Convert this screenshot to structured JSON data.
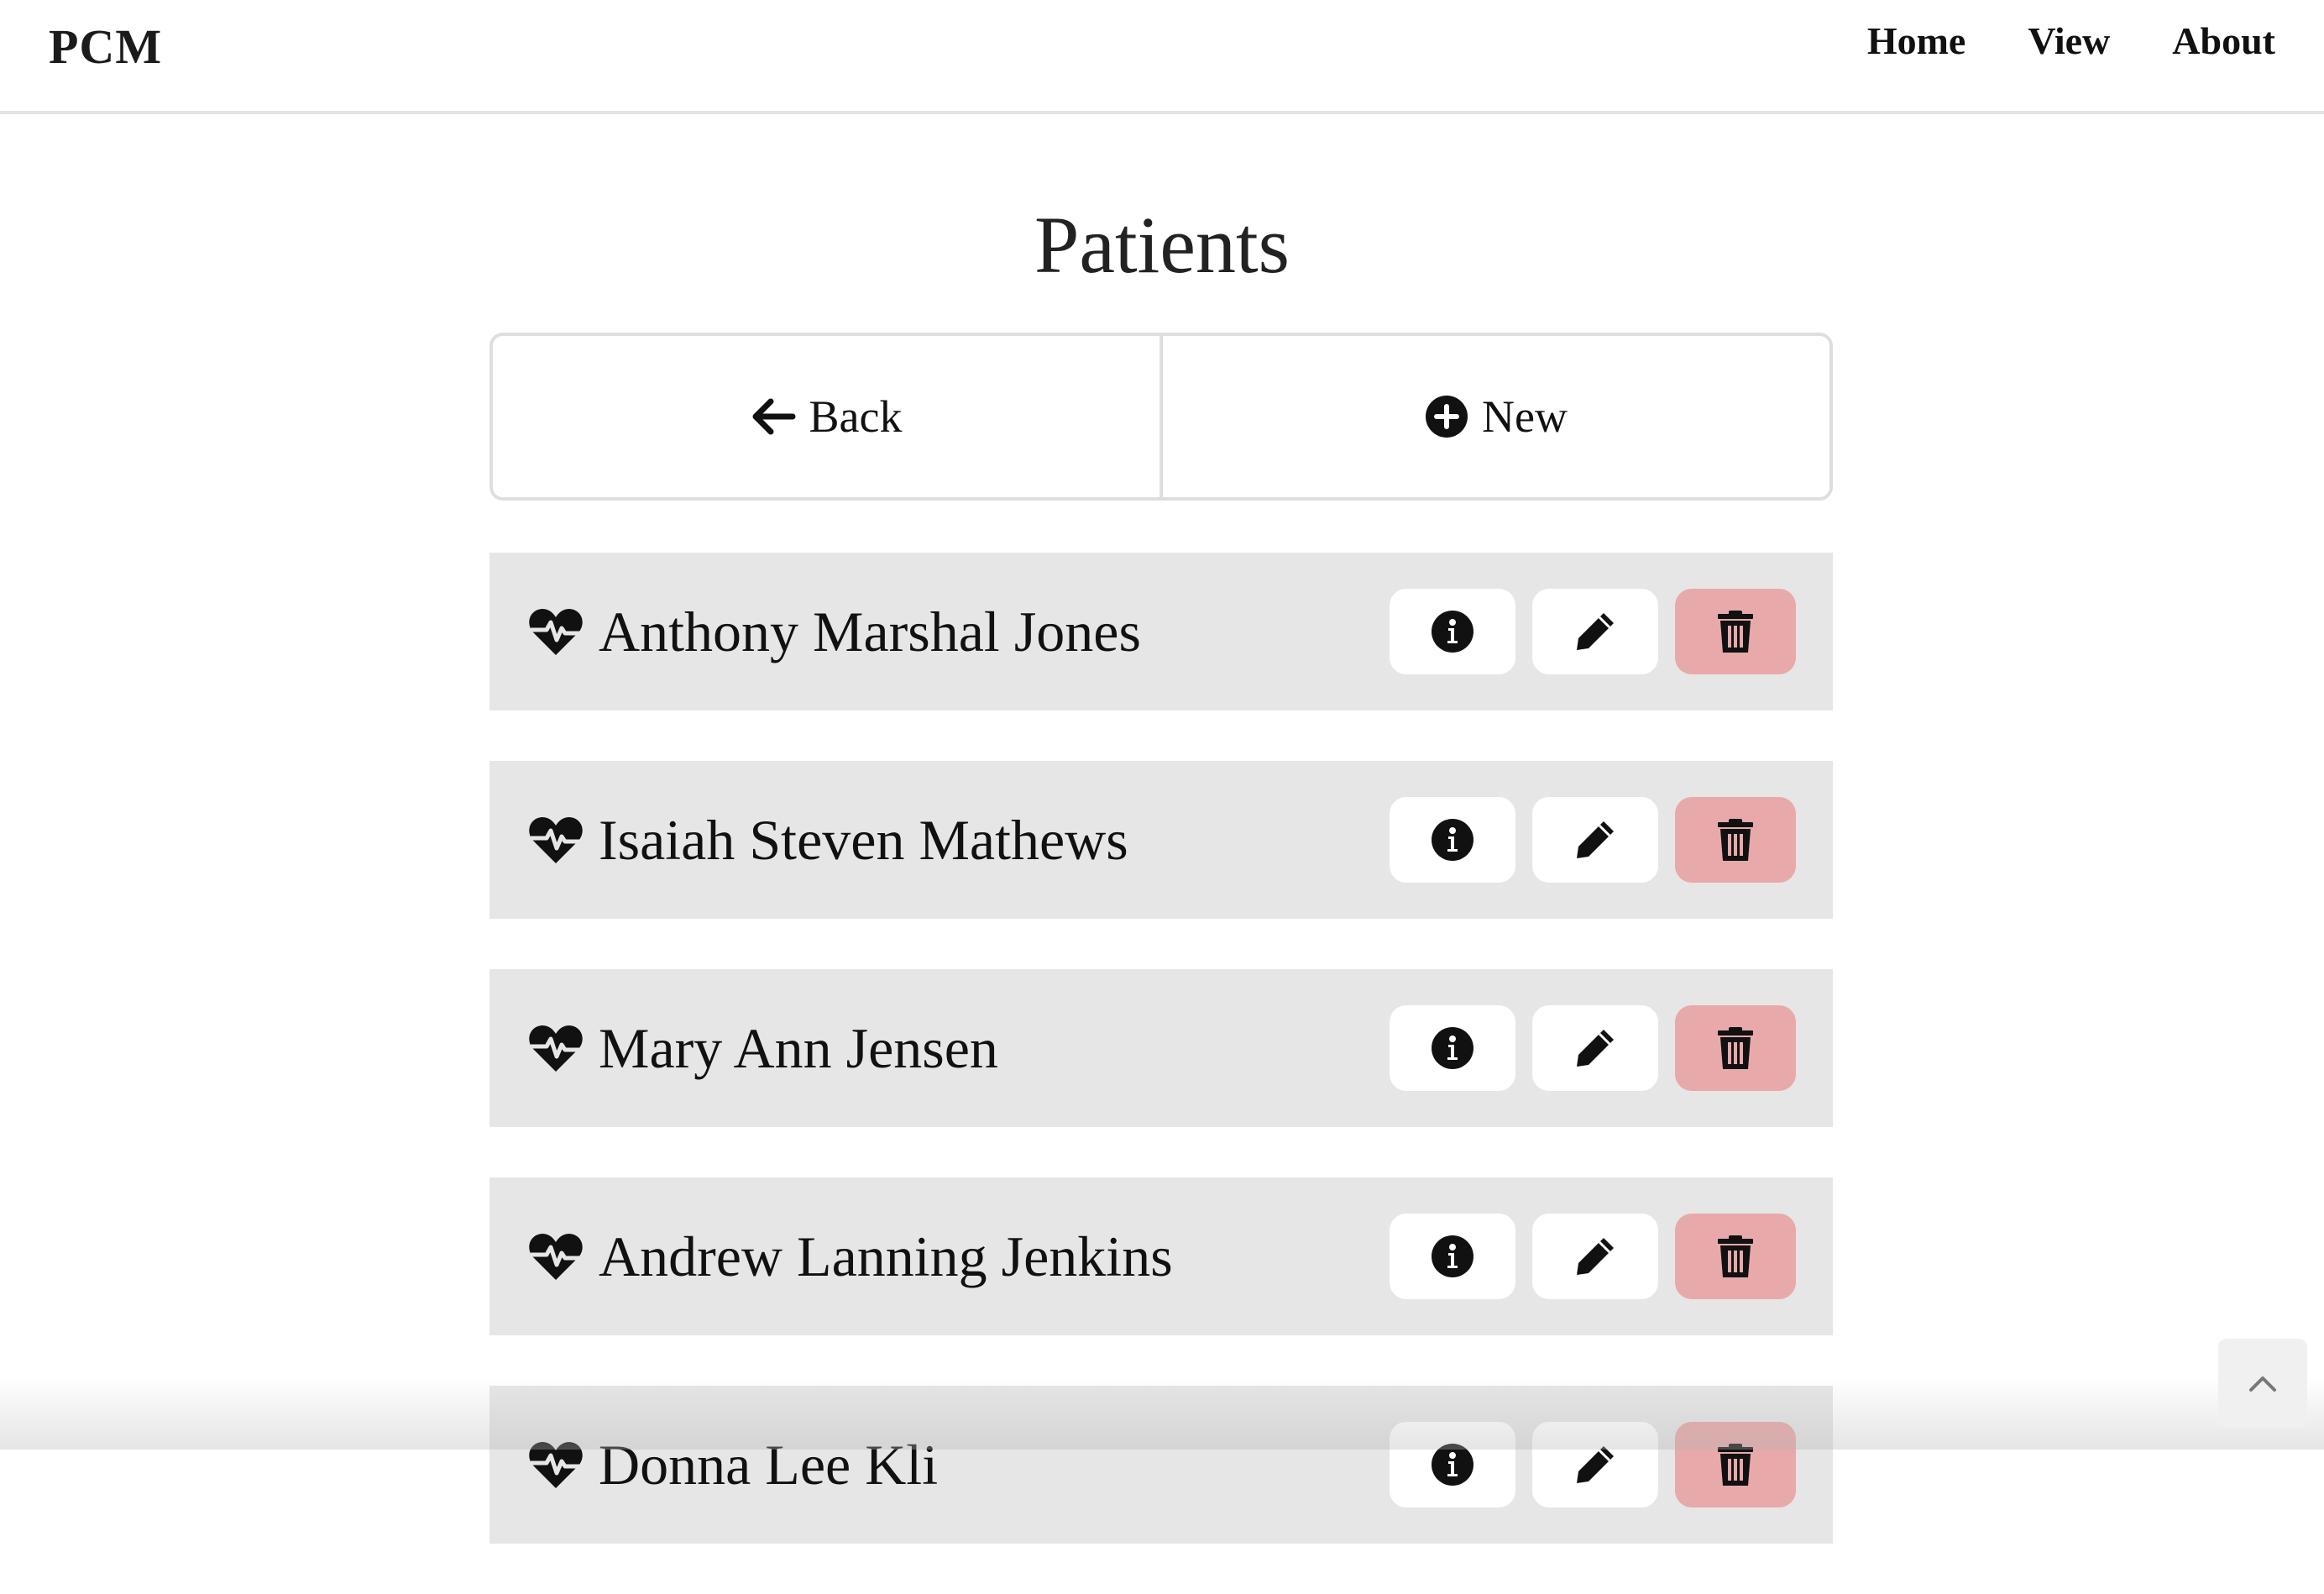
{
  "navbar": {
    "brand": "PCM",
    "links": [
      "Home",
      "View",
      "About"
    ]
  },
  "page": {
    "title": "Patients"
  },
  "toolbar": {
    "back_label": "Back",
    "new_label": "New"
  },
  "patients": [
    {
      "name": "Anthony Marshal Jones"
    },
    {
      "name": "Isaiah Steven Mathews"
    },
    {
      "name": "Mary Ann Jensen"
    },
    {
      "name": "Andrew Lanning Jenkins"
    },
    {
      "name": "Donna Lee Kli"
    }
  ],
  "icons": {
    "patient": "heart-pulse-icon",
    "info": "info-circle-icon",
    "edit": "pencil-icon",
    "delete": "trash-icon",
    "back": "arrow-left-icon",
    "new": "plus-circle-icon",
    "scroll": "chevron-up-icon"
  },
  "colors": {
    "row_background": "#e6e6e6",
    "delete_button": "#e8a9aa",
    "text": "#111111"
  }
}
